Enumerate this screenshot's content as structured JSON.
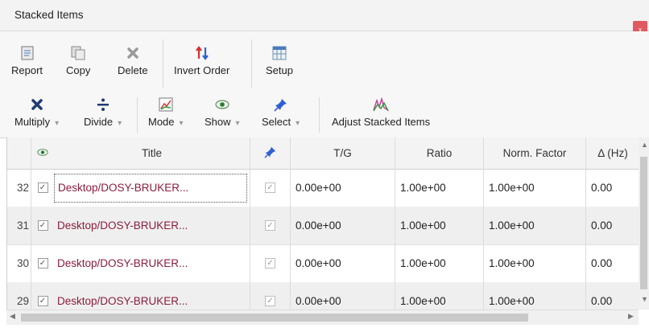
{
  "window": {
    "title": "Stacked Items",
    "close_glyph": "x"
  },
  "toolbar": {
    "row1": [
      {
        "label": "Report",
        "icon": "report-icon"
      },
      {
        "label": "Copy",
        "icon": "copy-icon"
      },
      {
        "label": "Delete",
        "icon": "delete-icon"
      },
      {
        "label": "Invert Order",
        "icon": "invert-order-icon"
      },
      {
        "label": "Setup",
        "icon": "setup-icon"
      }
    ],
    "row2": [
      {
        "label": "Multiply",
        "icon": "multiply-icon"
      },
      {
        "label": "Divide",
        "icon": "divide-icon"
      },
      {
        "label": "Mode",
        "icon": "mode-icon"
      },
      {
        "label": "Show",
        "icon": "show-eye-icon"
      },
      {
        "label": "Select",
        "icon": "select-pin-icon"
      },
      {
        "label": "Adjust Stacked Items",
        "icon": "adjust-stacked-items-icon"
      }
    ]
  },
  "table": {
    "columns": [
      "",
      "",
      "Title",
      "",
      "T/G",
      "Ratio",
      "Norm. Factor",
      "Δ (Hz)"
    ],
    "rows": [
      {
        "index": "32",
        "checked": true,
        "title": "Desktop/DOSY-BRUKER...",
        "selected": true,
        "tg": "0.00e+00",
        "ratio": "1.00e+00",
        "norm": "1.00e+00",
        "delta": "0.00"
      },
      {
        "index": "31",
        "checked": true,
        "title": "Desktop/DOSY-BRUKER...",
        "selected": true,
        "tg": "0.00e+00",
        "ratio": "1.00e+00",
        "norm": "1.00e+00",
        "delta": "0.00"
      },
      {
        "index": "30",
        "checked": true,
        "title": "Desktop/DOSY-BRUKER...",
        "selected": true,
        "tg": "0.00e+00",
        "ratio": "1.00e+00",
        "norm": "1.00e+00",
        "delta": "0.00"
      },
      {
        "index": "29",
        "checked": true,
        "title": "Desktop/DOSY-BRUKER...",
        "selected": true,
        "tg": "0.00e+00",
        "ratio": "1.00e+00",
        "norm": "1.00e+00",
        "delta": "0.00"
      }
    ]
  },
  "colors": {
    "title_text": "#8b1d3c",
    "close_bg": "#e05a61",
    "invert_up": "#d62f2f",
    "invert_down": "#2f5fd6"
  }
}
